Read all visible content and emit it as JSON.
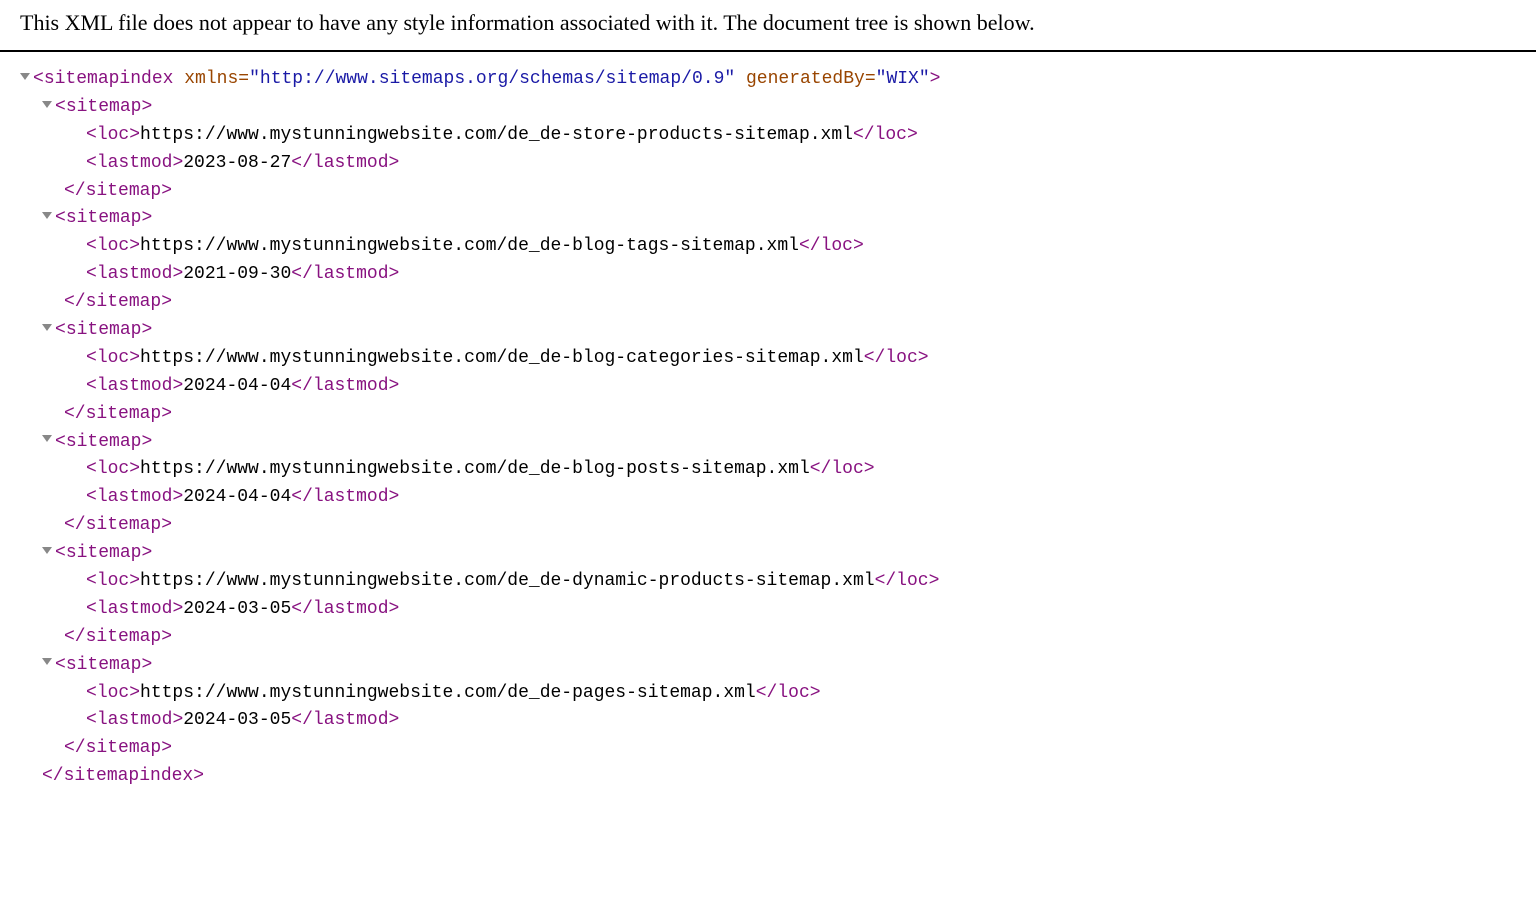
{
  "header": {
    "message": "This XML file does not appear to have any style information associated with it. The document tree is shown below."
  },
  "root": {
    "tagName": "sitemapindex",
    "attrs": [
      {
        "name": "xmlns",
        "value": "http://www.sitemaps.org/schemas/sitemap/0.9"
      },
      {
        "name": "generatedBy",
        "value": "WIX"
      }
    ]
  },
  "childTag": "sitemap",
  "locTag": "loc",
  "lastmodTag": "lastmod",
  "sitemaps": [
    {
      "loc": "https://www.mystunningwebsite.com/de_de-store-products-sitemap.xml",
      "lastmod": "2023-08-27"
    },
    {
      "loc": "https://www.mystunningwebsite.com/de_de-blog-tags-sitemap.xml",
      "lastmod": "2021-09-30"
    },
    {
      "loc": "https://www.mystunningwebsite.com/de_de-blog-categories-sitemap.xml",
      "lastmod": "2024-04-04"
    },
    {
      "loc": "https://www.mystunningwebsite.com/de_de-blog-posts-sitemap.xml",
      "lastmod": "2024-04-04"
    },
    {
      "loc": "https://www.mystunningwebsite.com/de_de-dynamic-products-sitemap.xml",
      "lastmod": "2024-03-05"
    },
    {
      "loc": "https://www.mystunningwebsite.com/de_de-pages-sitemap.xml",
      "lastmod": "2024-03-05"
    }
  ]
}
